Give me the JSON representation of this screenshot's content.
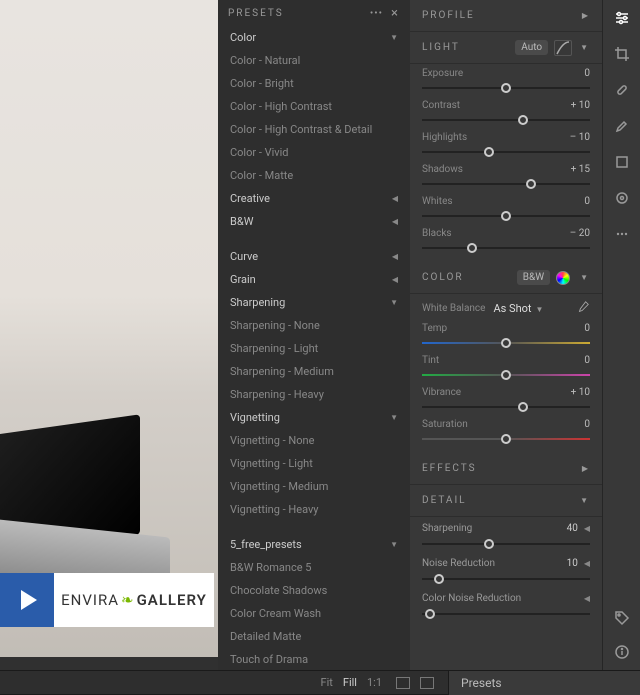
{
  "logo": {
    "envira": "ENVIRA",
    "gallery": "GALLERY"
  },
  "footer": {
    "fit": "Fit",
    "fill": "Fill",
    "oneone": "1:1",
    "presets": "Presets"
  },
  "presets": {
    "title": "PRESETS",
    "groups": [
      {
        "label": "Color",
        "open": true,
        "items": [
          "Color - Natural",
          "Color - Bright",
          "Color - High Contrast",
          "Color - High Contrast & Detail",
          "Color - Vivid",
          "Color - Matte"
        ]
      },
      {
        "label": "Creative",
        "open": false
      },
      {
        "label": "B&W",
        "open": false
      }
    ],
    "groups2": [
      {
        "label": "Curve",
        "open": false
      },
      {
        "label": "Grain",
        "open": false
      },
      {
        "label": "Sharpening",
        "open": true,
        "items": [
          "Sharpening - None",
          "Sharpening - Light",
          "Sharpening - Medium",
          "Sharpening - Heavy"
        ]
      },
      {
        "label": "Vignetting",
        "open": true,
        "items": [
          "Vignetting - None",
          "Vignetting - Light",
          "Vignetting - Medium",
          "Vignetting - Heavy"
        ]
      }
    ],
    "user": {
      "label": "5_free_presets",
      "open": true,
      "items": [
        "B&W Romance 5",
        "Chocolate Shadows",
        "Color Cream Wash",
        "Detailed Matte",
        "Touch of Drama"
      ]
    }
  },
  "edit": {
    "profile": "PROFILE",
    "light": {
      "title": "LIGHT",
      "auto": "Auto",
      "sliders": [
        {
          "name": "Exposure",
          "value": "0",
          "pos": 50
        },
        {
          "name": "Contrast",
          "value": "+ 10",
          "pos": 60
        },
        {
          "name": "Highlights",
          "value": "– 10",
          "pos": 40
        },
        {
          "name": "Shadows",
          "value": "+ 15",
          "pos": 65
        },
        {
          "name": "Whites",
          "value": "0",
          "pos": 50
        },
        {
          "name": "Blacks",
          "value": "– 20",
          "pos": 30
        }
      ]
    },
    "color": {
      "title": "COLOR",
      "bw": "B&W",
      "wb_label": "White Balance",
      "wb_value": "As Shot",
      "sliders": [
        {
          "name": "Temp",
          "value": "0",
          "pos": 50,
          "grad": "temp"
        },
        {
          "name": "Tint",
          "value": "0",
          "pos": 50,
          "grad": "tint"
        },
        {
          "name": "Vibrance",
          "value": "+ 10",
          "pos": 60,
          "grad": ""
        },
        {
          "name": "Saturation",
          "value": "0",
          "pos": 50,
          "grad": "sat"
        }
      ]
    },
    "effects": "EFFECTS",
    "detail": {
      "title": "DETAIL",
      "rows": [
        {
          "name": "Sharpening",
          "value": "40",
          "pos": 40
        },
        {
          "name": "Noise Reduction",
          "value": "10",
          "pos": 10
        },
        {
          "name": "Color Noise Reduction",
          "value": "",
          "pos": 5
        }
      ]
    }
  }
}
